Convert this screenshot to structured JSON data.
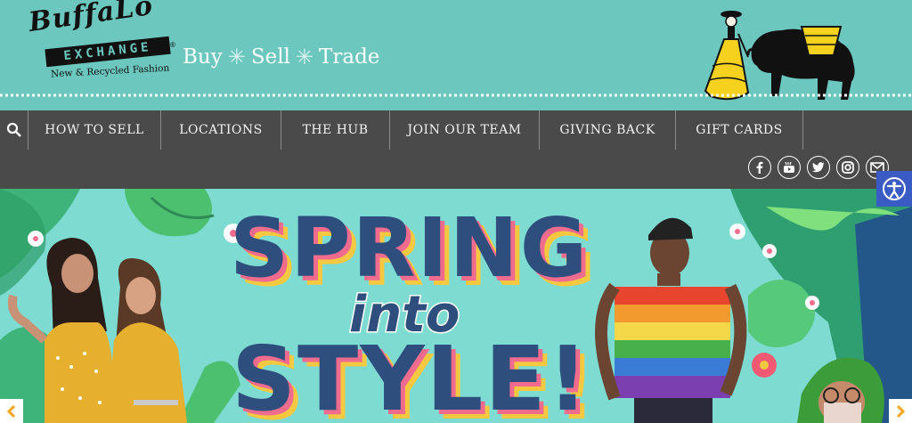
{
  "logo": {
    "wordmark": "BuffaLo",
    "exchange": "EXCHANGE",
    "registered": "®",
    "subtitle": "New & Recycled Fashion"
  },
  "tagline": {
    "words": [
      "Buy",
      "Sell",
      "Trade"
    ],
    "separator": "✳"
  },
  "nav": {
    "search_icon": "search-icon",
    "items": [
      "HOW TO SELL",
      "LOCATIONS",
      "THE HUB",
      "JOIN OUR TEAM",
      "GIVING BACK",
      "GIFT CARDS"
    ]
  },
  "social": {
    "icons": [
      "facebook-icon",
      "youtube-icon",
      "twitter-icon",
      "instagram-icon",
      "email-icon"
    ]
  },
  "accessibility": {
    "icon": "accessibility-icon"
  },
  "hero": {
    "line1": "SPRING",
    "line2": "into",
    "line3": "STYLE!"
  },
  "colors": {
    "header_bg": "#6cc7bf",
    "nav_bg": "#4a4a4a",
    "hero_bg": "#7edbd2",
    "headline_blue": "#2e4f7d",
    "headline_shadow_pink": "#f06c8f",
    "headline_shadow_yellow": "#f5c842",
    "a11y_blue": "#3b5bc4"
  }
}
